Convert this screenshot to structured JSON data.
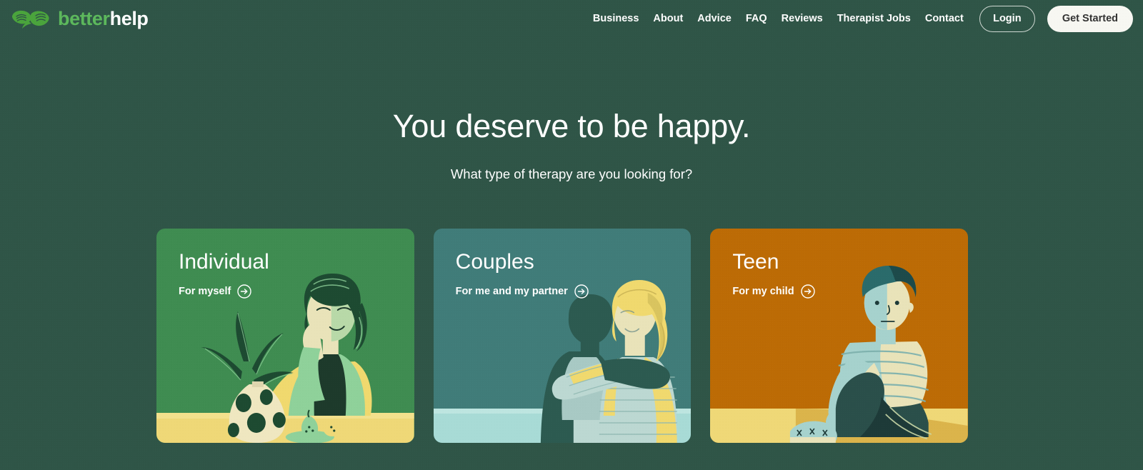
{
  "page": {
    "background_color": "#2f5547"
  },
  "header": {
    "logo": {
      "icon": "betterhelp-leaf-logo",
      "text_primary": "better",
      "text_secondary": "help",
      "color_primary": "#5cb85c",
      "color_secondary": "#ffffff"
    },
    "nav_links": [
      {
        "label": "Business"
      },
      {
        "label": "About"
      },
      {
        "label": "Advice"
      },
      {
        "label": "FAQ"
      },
      {
        "label": "Reviews"
      },
      {
        "label": "Therapist Jobs"
      },
      {
        "label": "Contact"
      }
    ],
    "login_label": "Login",
    "get_started_label": "Get Started"
  },
  "hero": {
    "title": "You deserve to be happy.",
    "subtitle": "What type of therapy are you looking for?"
  },
  "cards": [
    {
      "title": "Individual",
      "cta": "For myself",
      "cta_icon": "arrow-right-circle-icon",
      "bg_color": "#3f8c51",
      "art": "woman-with-plant-illustration"
    },
    {
      "title": "Couples",
      "cta": "For me and my partner",
      "cta_icon": "arrow-right-circle-icon",
      "bg_color": "#407c79",
      "art": "couple-hugging-illustration"
    },
    {
      "title": "Teen",
      "cta": "For my child",
      "cta_icon": "arrow-right-circle-icon",
      "bg_color": "#bc6b05",
      "art": "teen-sitting-illustration"
    }
  ]
}
